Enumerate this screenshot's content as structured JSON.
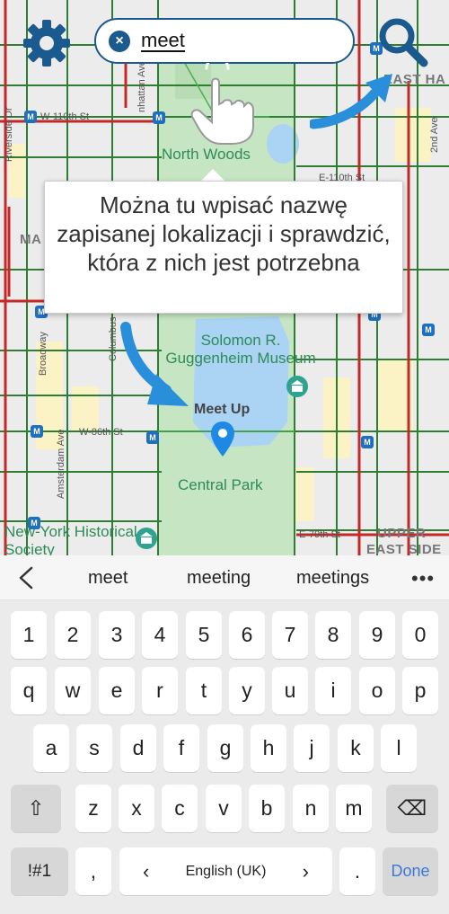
{
  "map": {
    "search_value": "meet",
    "clear_glyph": "×",
    "tooltip_text": "Można tu wpisać nazwę zapisanej lokalizacji i sprawdzić, która z nich jest potrzebna",
    "marker_label": "Meet Up",
    "poi_labels": {
      "north_woods": "North Woods",
      "guggenheim": "Solomon R. Guggenheim Museum",
      "central_park": "Central Park",
      "new_york_historical": "New-York Historical Society"
    },
    "street_labels": {
      "w110": "W-110th St",
      "w86": "W-86th St",
      "e79": "E-79th St",
      "e110": "E-110th St",
      "riverside": "Riverside Dr",
      "broadway": "Broadway",
      "columbus": "Columbus",
      "amsterdam": "Amsterdam Ave",
      "manhattan": "nhattan Ave",
      "second_ave": "2nd Ave"
    },
    "district_labels": {
      "east_harlem": "EAST HA",
      "upper": "UPPER",
      "east_side": "EAST SIDE",
      "ma": "MA"
    },
    "metro_glyph": "M",
    "icons": [
      "settings-gear-icon",
      "search-icon",
      "clear-icon",
      "tap-hand-icon",
      "pointer-arrow-icon",
      "location-pin-icon",
      "museum-icon"
    ],
    "colors": {
      "brand": "#1a5a8f",
      "arrow": "#2a8fdb",
      "park": "#c6e6c3",
      "water": "#aad3f4",
      "road": "#2e7d32",
      "road_hot": "#c62828"
    }
  },
  "suggestions": {
    "back_glyph": "<",
    "items": [
      "meet",
      "meeting",
      "meetings"
    ],
    "more_glyph": "•••"
  },
  "keyboard": {
    "row_numbers": [
      "1",
      "2",
      "3",
      "4",
      "5",
      "6",
      "7",
      "8",
      "9",
      "0"
    ],
    "row_top": [
      "q",
      "w",
      "e",
      "r",
      "t",
      "y",
      "u",
      "i",
      "o",
      "p"
    ],
    "row_home": [
      "a",
      "s",
      "d",
      "f",
      "g",
      "h",
      "j",
      "k",
      "l"
    ],
    "row_bottom": [
      "z",
      "x",
      "c",
      "v",
      "b",
      "n",
      "m"
    ],
    "shift_glyph": "⇧",
    "backspace_glyph": "⌫",
    "symbols_label": "!#1",
    "comma_label": ",",
    "lang_prev": "‹",
    "language_label": "English (UK)",
    "lang_next": "›",
    "period_label": ".",
    "done_label": "Done"
  }
}
